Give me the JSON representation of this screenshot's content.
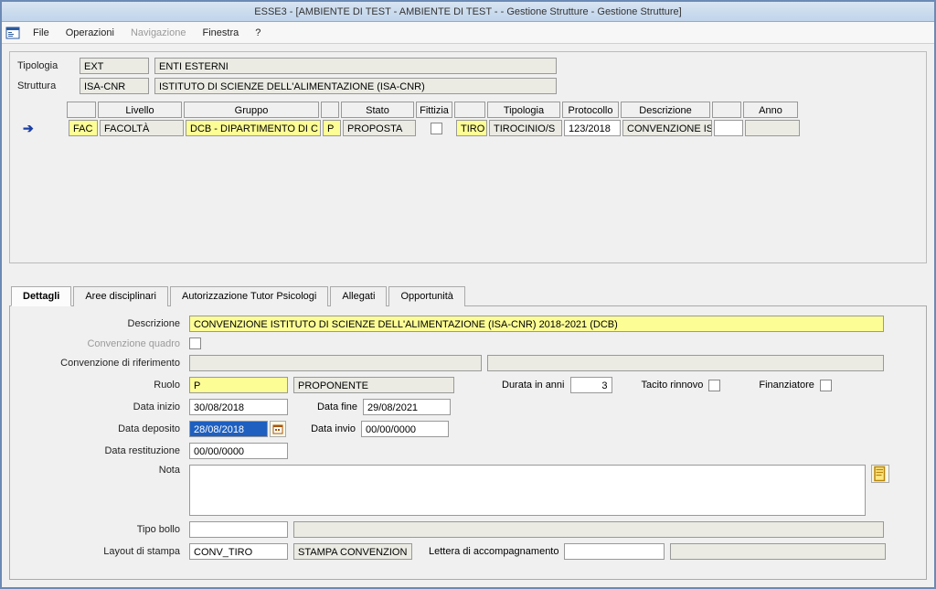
{
  "titlebar": "ESSE3 - [AMBIENTE DI TEST - AMBIENTE DI TEST -  - Gestione Strutture - Gestione Strutture]",
  "menu": {
    "file": "File",
    "operazioni": "Operazioni",
    "navigazione": "Navigazione",
    "finestra": "Finestra",
    "help": "?"
  },
  "header": {
    "tipologia_label": "Tipologia",
    "tipologia_code": "EXT",
    "tipologia_desc": "ENTI ESTERNI",
    "struttura_label": "Struttura",
    "struttura_code": "ISA-CNR",
    "struttura_desc": "ISTITUTO DI SCIENZE DELL'ALIMENTAZIONE (ISA-CNR)"
  },
  "columns": {
    "livello": "Livello",
    "gruppo": "Gruppo",
    "stato": "Stato",
    "fittizia": "Fittizia",
    "tipologia": "Tipologia",
    "protocollo": "Protocollo",
    "descrizione": "Descrizione",
    "anno": "Anno"
  },
  "row": {
    "livello_code": "FAC",
    "livello_desc": "FACOLTÀ",
    "gruppo_code": "DCB - DIPARTIMENTO DI C",
    "stato_code": "P",
    "stato_desc": "PROPOSTA",
    "tipologia_code": "TIRO",
    "tipologia_desc": "TIROCINIO/S",
    "protocollo": "123/2018",
    "descrizione": "CONVENZIONE IS",
    "anno": ""
  },
  "tabs": {
    "dettagli": "Dettagli",
    "aree": "Aree disciplinari",
    "autorizzazione": "Autorizzazione Tutor Psicologi",
    "allegati": "Allegati",
    "opportunita": "Opportunità"
  },
  "form": {
    "descrizione_label": "Descrizione",
    "descrizione_value": "CONVENZIONE ISTITUTO DI SCIENZE DELL'ALIMENTAZIONE (ISA-CNR) 2018-2021 (DCB)",
    "conv_quadro_label": "Convenzione quadro",
    "conv_rif_label": "Convenzione di riferimento",
    "conv_rif_a": "",
    "conv_rif_b": "",
    "ruolo_label": "Ruolo",
    "ruolo_code": "P",
    "ruolo_desc": "PROPONENTE",
    "durata_label": "Durata in anni",
    "durata_value": "3",
    "tacito_label": "Tacito rinnovo",
    "finanziatore_label": "Finanziatore",
    "data_inizio_label": "Data inizio",
    "data_inizio": "30/08/2018",
    "data_fine_label": "Data fine",
    "data_fine": "29/08/2021",
    "data_deposito_label": "Data deposito",
    "data_deposito": "28/08/2018",
    "data_invio_label": "Data invio",
    "data_invio": "00/00/0000",
    "data_restituzione_label": "Data restituzione",
    "data_restituzione": "00/00/0000",
    "nota_label": "Nota",
    "tipo_bollo_label": "Tipo bollo",
    "tipo_bollo_a": "",
    "tipo_bollo_b": "",
    "layout_label": "Layout di stampa",
    "layout_code": "CONV_TIRO",
    "layout_desc": "STAMPA CONVENZION",
    "lettera_label": "Lettera di accompagnamento",
    "lettera_a": "",
    "lettera_b": ""
  }
}
